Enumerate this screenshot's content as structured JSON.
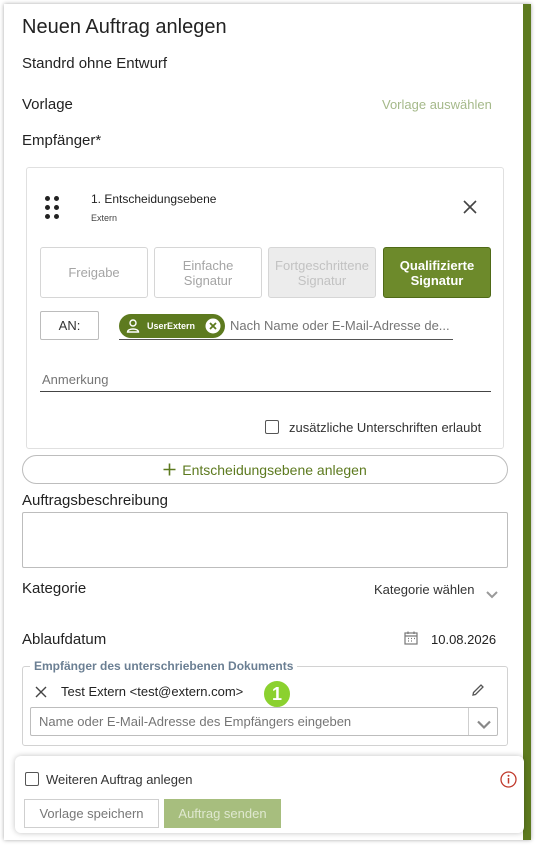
{
  "header": {
    "title": "Neuen Auftrag anlegen",
    "subtitle": "Standrd ohne Entwurf"
  },
  "template": {
    "label": "Vorlage",
    "select_link": "Vorlage auswählen"
  },
  "recipients": {
    "label": "Empfänger*",
    "level": {
      "title": "1. Entscheidungsebene",
      "subtitle": "Extern"
    },
    "signature_types": [
      {
        "label_line1": "Freigabe",
        "label_line2": "",
        "state": "default"
      },
      {
        "label_line1": "Einfache",
        "label_line2": "Signatur",
        "state": "default"
      },
      {
        "label_line1": "Fortgeschrittene",
        "label_line2": "Signatur",
        "state": "disabled"
      },
      {
        "label_line1": "Qualifizierte",
        "label_line2": "Signatur",
        "state": "active"
      }
    ],
    "to_button": "AN:",
    "chip_user": "UserExtern",
    "search_placeholder": "Nach Name oder E-Mail-Adresse de...",
    "note_placeholder": "Anmerkung",
    "additional_signatures_label": "zusätzliche Unterschriften erlaubt",
    "additional_signatures_checked": false
  },
  "add_level_button": "Entscheidungsebene anlegen",
  "description": {
    "label": "Auftragsbeschreibung",
    "value": ""
  },
  "category": {
    "label": "Kategorie",
    "select_label": "Kategorie wählen"
  },
  "expiry": {
    "label": "Ablaufdatum",
    "date": "10.08.2026"
  },
  "signed_doc_recipients": {
    "legend": "Empfänger des unterschriebenen Dokuments",
    "entries": [
      {
        "text": "Test Extern <test@extern.com>"
      }
    ],
    "badge": "1",
    "input_placeholder": "Name oder E-Mail-Adresse des Empfängers eingeben"
  },
  "footer": {
    "another_order_label": "Weiteren Auftrag anlegen",
    "another_order_checked": false,
    "save_template_button": "Vorlage speichern",
    "send_button": "Auftrag senden"
  },
  "colors": {
    "accent": "#5d7a1f",
    "accent_active": "#6d8a2b",
    "link": "#a5b98a",
    "badge": "#8bd12f",
    "info_icon": "#c0392b"
  },
  "icons": {
    "drag": "drag-handle-icon",
    "close": "close-icon",
    "user": "user-icon",
    "remove": "remove-circle-icon",
    "plus": "plus-icon",
    "chevron": "chevron-down-icon",
    "calendar": "calendar-icon",
    "edit": "pencil-icon",
    "info": "info-icon"
  }
}
